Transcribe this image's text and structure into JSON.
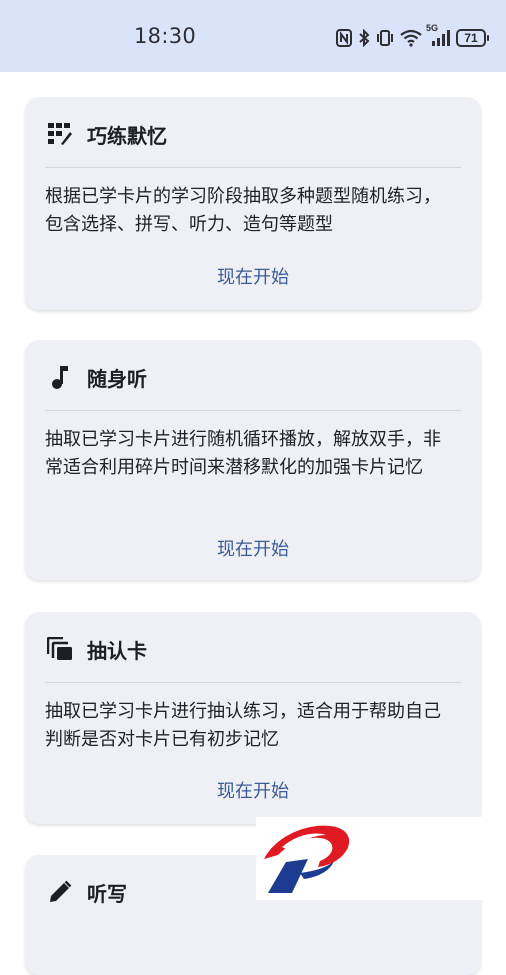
{
  "status_bar": {
    "time": "18:30",
    "battery": "71",
    "network": "5G"
  },
  "cards": [
    {
      "title": "巧练默忆",
      "icon": "quiz-practice-icon",
      "description": "根据已学卡片的学习阶段抽取多种题型随机练习，包含选择、拼写、听力、造句等题型",
      "action": "现在开始"
    },
    {
      "title": "随身听",
      "icon": "music-note-icon",
      "description": "抽取已学习卡片进行随机循环播放，解放双手，非常适合利用碎片时间来潜移默化的加强卡片记忆",
      "action": "现在开始"
    },
    {
      "title": "抽认卡",
      "icon": "flashcards-icon",
      "description": "抽取已学习卡片进行抽认练习，适合用于帮助自己判断是否对卡片已有初步记忆",
      "action": "现在开始"
    },
    {
      "title": "听写",
      "icon": "pencil-icon"
    }
  ],
  "colors": {
    "status_bar_bg": "#d9e4fb",
    "card_bg": "#eff0f5",
    "accent": "#3b5b98",
    "logo_red": "#e01a22",
    "logo_blue": "#1d3c91"
  }
}
